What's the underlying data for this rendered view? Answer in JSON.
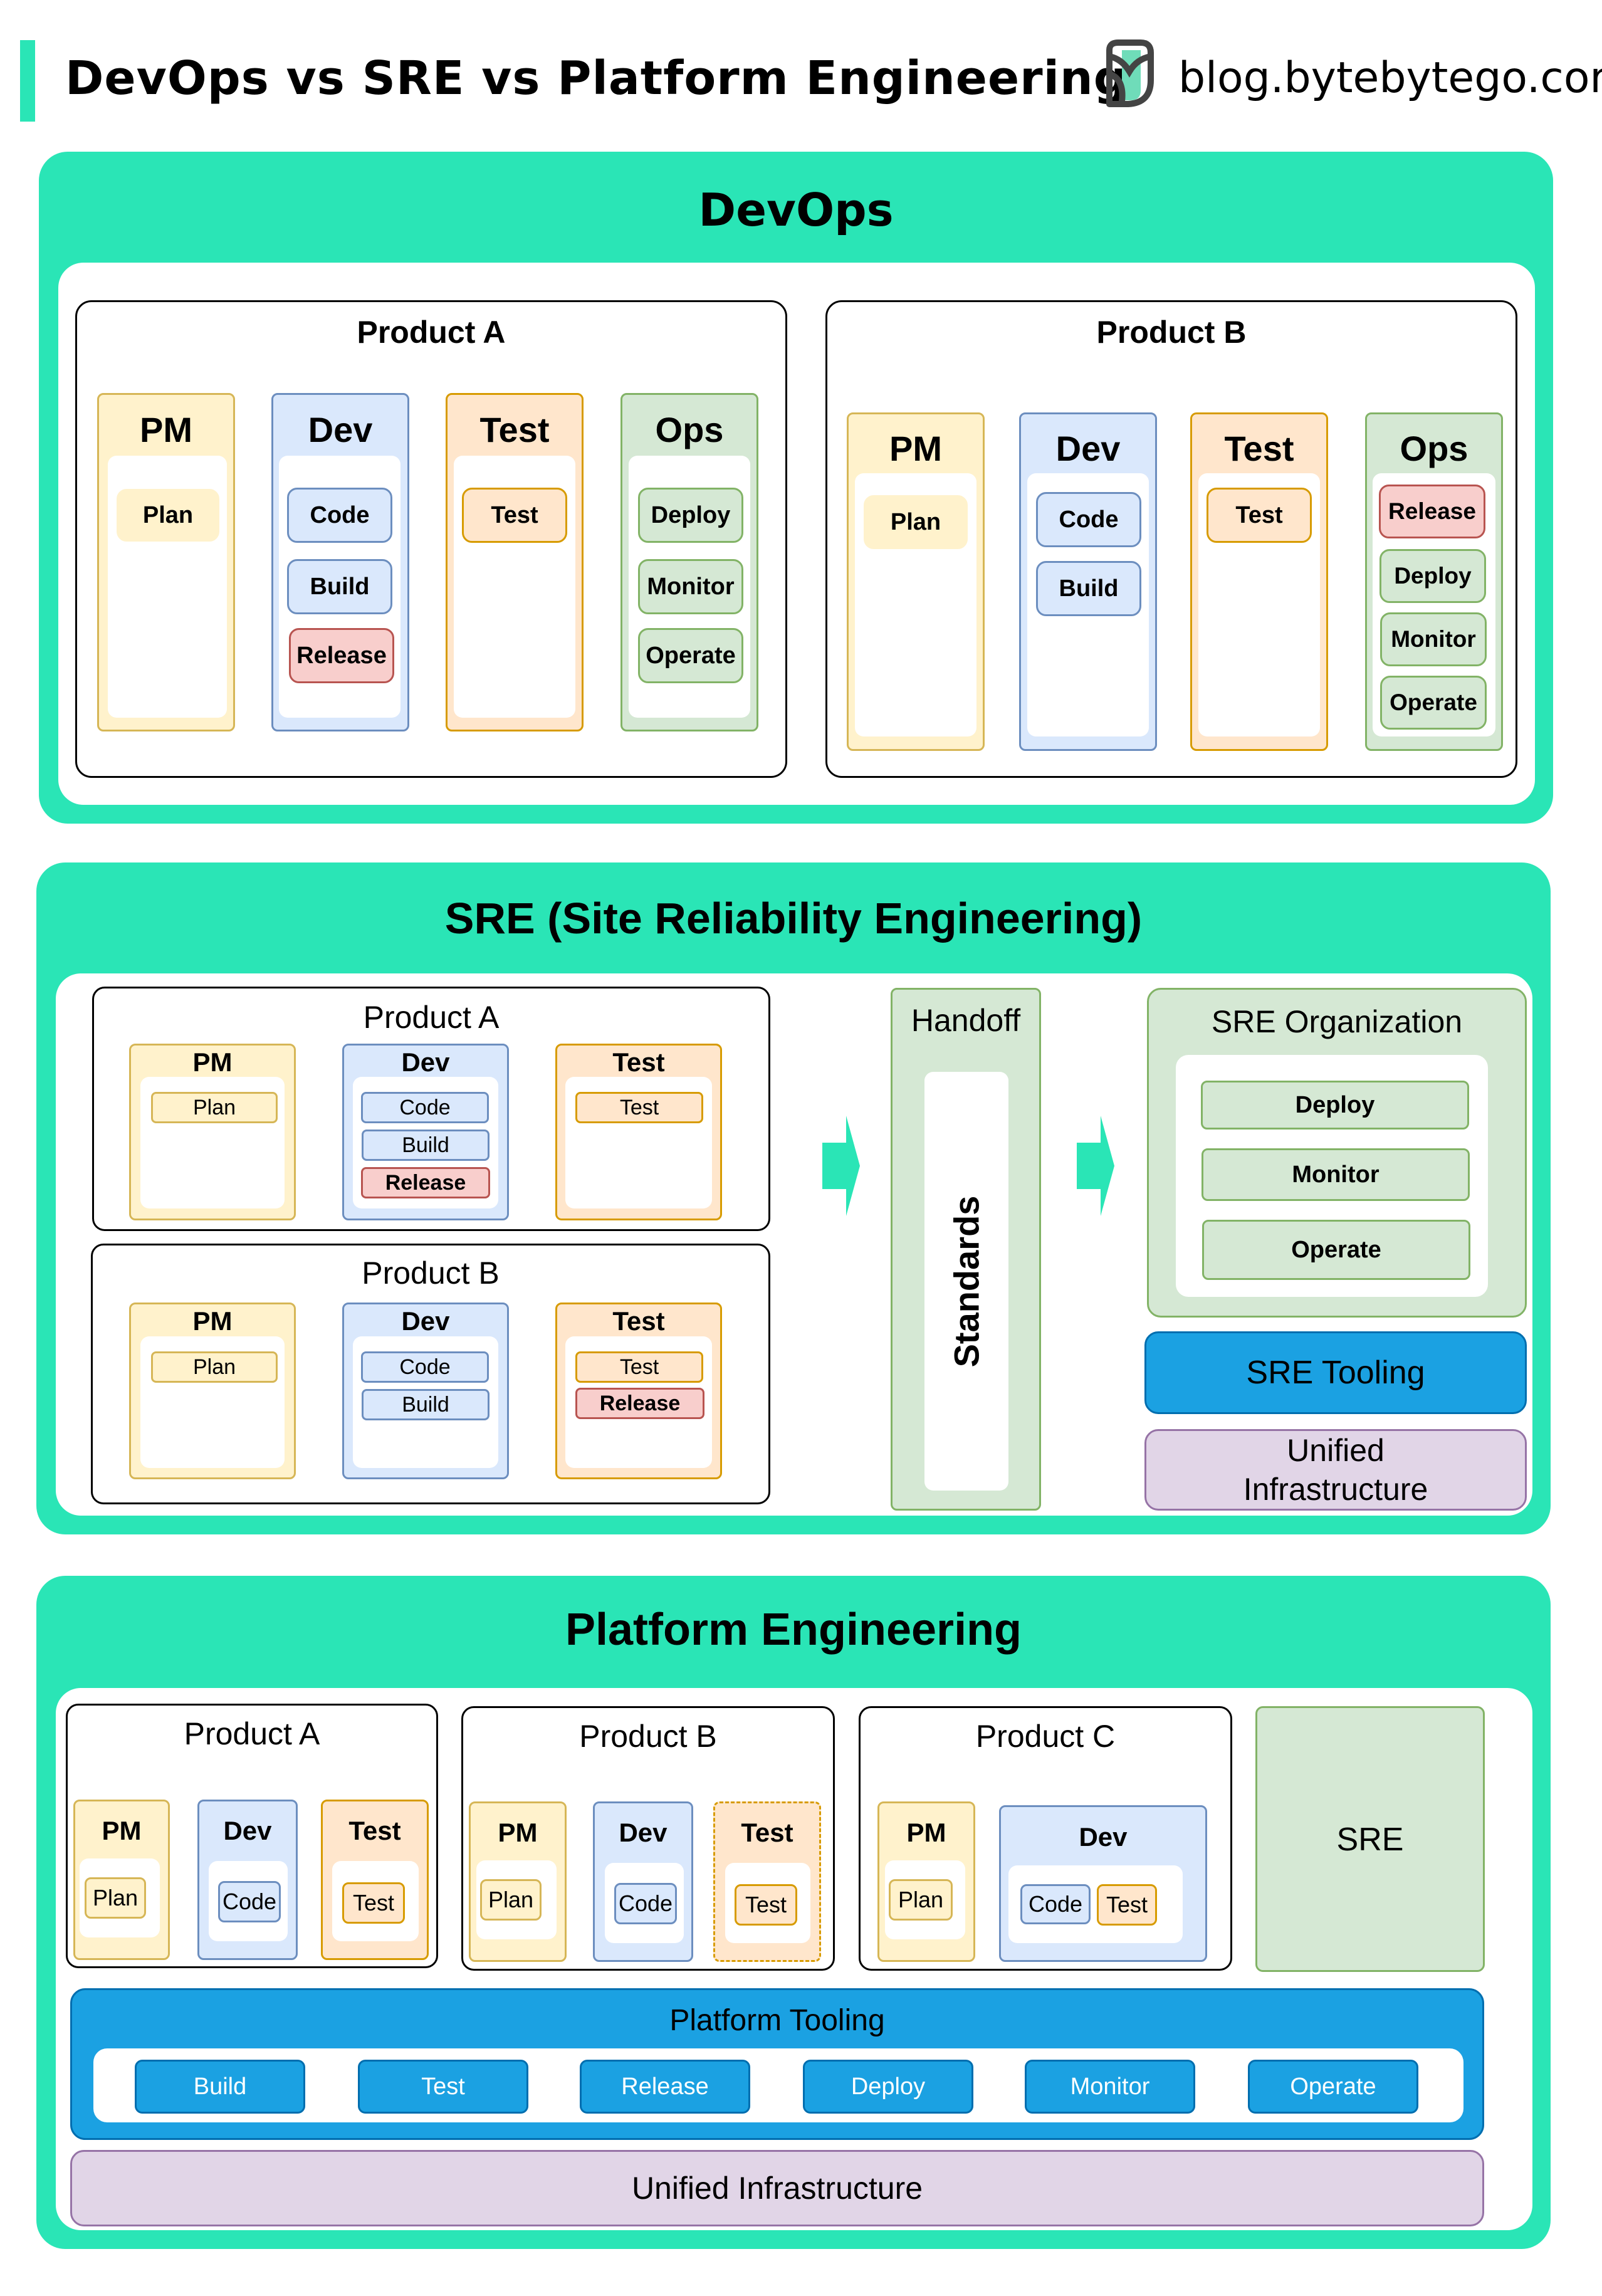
{
  "header": {
    "title": "DevOps vs SRE vs Platform Engineering",
    "site": "blog.bytebytego.com",
    "logo_icon": "bytebytego-logo-icon",
    "accent_color": "#2ae5b6"
  },
  "colors": {
    "section_bg": "#2ae5b6",
    "pm_fill": "#fff2cc",
    "pm_stroke": "#d6b656",
    "dev_fill": "#dae8fc",
    "dev_stroke": "#6c8ebf",
    "test_fill": "#ffe6cc",
    "test_stroke": "#d79b00",
    "ops_fill": "#d5e8d4",
    "ops_stroke": "#82b366",
    "release_fill": "#f8cecc",
    "release_stroke": "#b85450",
    "tooling_fill": "#1ba1e2",
    "tooling_stroke": "#006eaf",
    "infra_fill": "#e1d5e7",
    "infra_stroke": "#9673a6"
  },
  "devops": {
    "title": "DevOps",
    "product_a": {
      "title": "Product A",
      "columns": [
        {
          "label": "PM",
          "items": [
            "Plan"
          ]
        },
        {
          "label": "Dev",
          "items": [
            "Code",
            "Build",
            "Release"
          ]
        },
        {
          "label": "Test",
          "items": [
            "Test"
          ]
        },
        {
          "label": "Ops",
          "items": [
            "Deploy",
            "Monitor",
            "Operate"
          ]
        }
      ]
    },
    "product_b": {
      "title": "Product B",
      "columns": [
        {
          "label": "PM",
          "items": [
            "Plan"
          ]
        },
        {
          "label": "Dev",
          "items": [
            "Code",
            "Build"
          ]
        },
        {
          "label": "Test",
          "items": [
            "Test"
          ]
        },
        {
          "label": "Ops",
          "items": [
            "Release",
            "Deploy",
            "Monitor",
            "Operate"
          ]
        }
      ]
    }
  },
  "sre": {
    "title": "SRE (Site Reliability Engineering)",
    "product_a": {
      "title": "Product A",
      "columns": [
        {
          "label": "PM",
          "items": [
            "Plan"
          ]
        },
        {
          "label": "Dev",
          "items": [
            "Code",
            "Build",
            "Release"
          ]
        },
        {
          "label": "Test",
          "items": [
            "Test"
          ]
        }
      ]
    },
    "product_b": {
      "title": "Product B",
      "columns": [
        {
          "label": "PM",
          "items": [
            "Plan"
          ]
        },
        {
          "label": "Dev",
          "items": [
            "Code",
            "Build"
          ]
        },
        {
          "label": "Test",
          "items": [
            "Test",
            "Release"
          ]
        }
      ]
    },
    "handoff": {
      "title": "Handoff",
      "standards": "Standards"
    },
    "sre_org": {
      "title": "SRE Organization",
      "items": [
        "Deploy",
        "Monitor",
        "Operate"
      ]
    },
    "tooling": "SRE Tooling",
    "infra": "Unified Infrastructure"
  },
  "platform": {
    "title": "Platform Engineering",
    "product_a": {
      "title": "Product A",
      "columns": [
        {
          "label": "PM",
          "items": [
            "Plan"
          ]
        },
        {
          "label": "Dev",
          "items": [
            "Code"
          ]
        },
        {
          "label": "Test",
          "items": [
            "Test"
          ]
        }
      ]
    },
    "product_b": {
      "title": "Product B",
      "columns": [
        {
          "label": "PM",
          "items": [
            "Plan"
          ]
        },
        {
          "label": "Dev",
          "items": [
            "Code"
          ]
        },
        {
          "label": "Test",
          "items": [
            "Test"
          ]
        }
      ]
    },
    "product_c": {
      "title": "Product C",
      "columns": [
        {
          "label": "PM",
          "items": [
            "Plan"
          ]
        },
        {
          "label": "Dev",
          "items": [
            "Code",
            "Test"
          ]
        }
      ]
    },
    "sre": "SRE",
    "tooling": {
      "title": "Platform Tooling",
      "items": [
        "Build",
        "Test",
        "Release",
        "Deploy",
        "Monitor",
        "Operate"
      ]
    },
    "infra": "Unified Infrastructure"
  }
}
